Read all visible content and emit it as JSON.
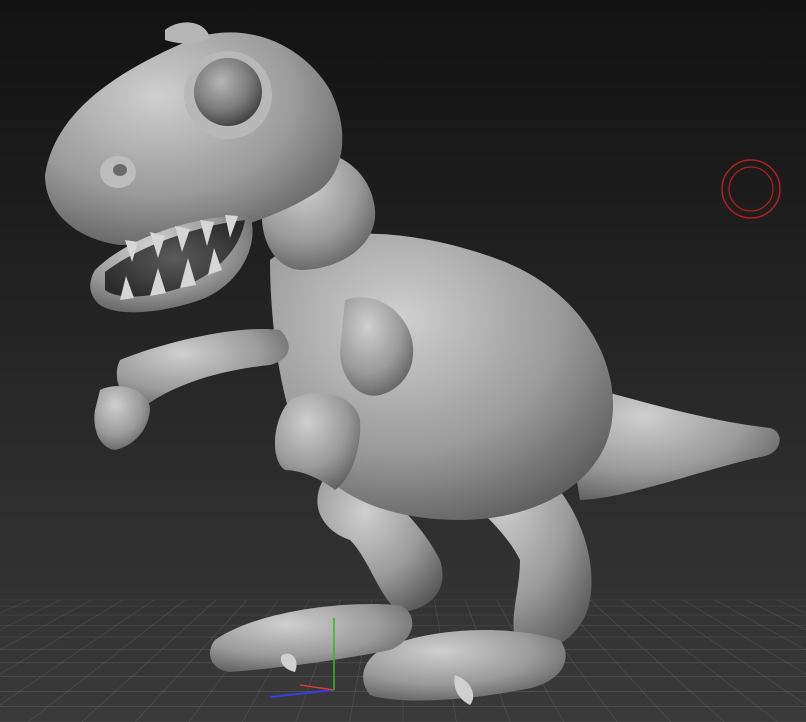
{
  "viewport": {
    "background_top": "#121212",
    "background_bottom": "#3a3a3a",
    "grid_color": "#6a6a6a",
    "axis_colors": {
      "x": "#3b3bd8",
      "y": "#21c21d",
      "z": "#d03a3a"
    }
  },
  "model": {
    "name": "dinosaur-sculpt",
    "base_color": "#9a9a9a",
    "highlight_color": "#cfcfcf",
    "shadow_color": "#4e4e4e",
    "eye_color": "#7a7a7a"
  },
  "brush_cursor": {
    "icon": "brush-cursor-icon",
    "color": "#b01f1f"
  }
}
